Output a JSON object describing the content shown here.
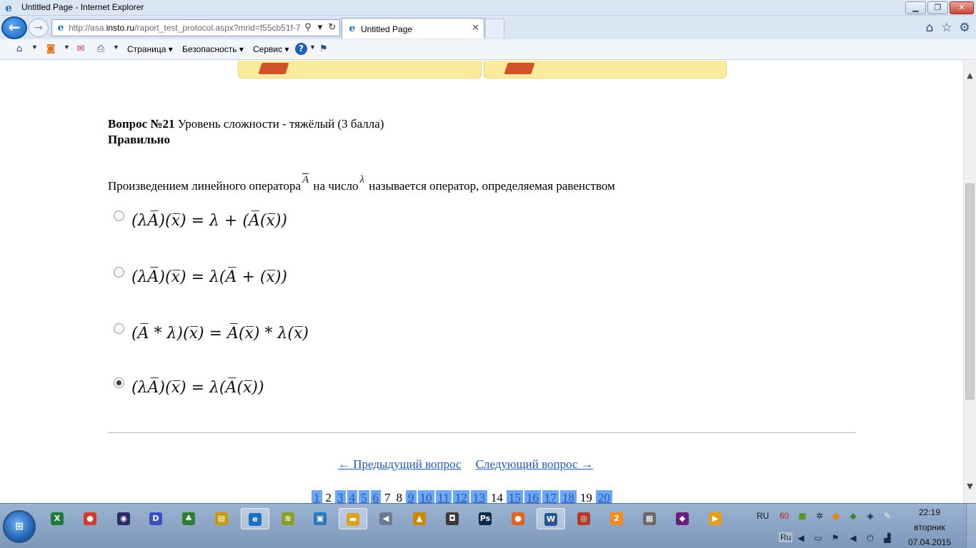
{
  "window": {
    "title": "Untitled Page - Internet Explorer"
  },
  "navbar": {
    "url_prefix": "http://asa.",
    "url_domain": "insto.ru",
    "url_path": "/raport_test_protocol.aspx?mrid=f55cb51f-7",
    "tab_label": "Untitled Page"
  },
  "cmdbar": {
    "menu_page": "Страница",
    "menu_security": "Безопасность",
    "menu_service": "Сервис"
  },
  "question": {
    "heading_bold": "Вопрос №21",
    "heading_rest": " Уровень сложности - тяжёлый (3 балла)",
    "status": "Правильно",
    "text_part1": "Произведением линейного оператора",
    "operator_symbol": "A",
    "text_part2": "на число",
    "lambda_symbol": "λ",
    "text_part3": "называется оператор, определяемая равенством"
  },
  "options": [
    {
      "formula": "(λA̅)(x̅) = λ + (A̅(x̅))",
      "selected": false
    },
    {
      "formula": "(λA̅)(x̅) = λ(A̅ + (x̅))",
      "selected": false
    },
    {
      "formula": "(A̅ * λ)(x̅) = A̅(x̅) * λ(x̅)",
      "selected": false
    },
    {
      "formula": "(λA̅)(x̅) = λ(A̅(x̅))",
      "selected": true
    }
  ],
  "navigation": {
    "prev": "← Предыдущий вопрос",
    "next": "Следующий вопрос →"
  },
  "pager": [
    {
      "label": "1",
      "answered": true
    },
    {
      "label": "2",
      "answered": false
    },
    {
      "label": "3",
      "answered": true
    },
    {
      "label": "4",
      "answered": true
    },
    {
      "label": "5",
      "answered": true
    },
    {
      "label": "6",
      "answered": true
    },
    {
      "label": "7",
      "answered": false
    },
    {
      "label": "8",
      "answered": false
    },
    {
      "label": "9",
      "answered": true
    },
    {
      "label": "10",
      "answered": true
    },
    {
      "label": "11",
      "answered": true
    },
    {
      "label": "12",
      "answered": true
    },
    {
      "label": "13",
      "answered": true
    },
    {
      "label": "14",
      "answered": false
    },
    {
      "label": "15",
      "answered": true
    },
    {
      "label": "16",
      "answered": true
    },
    {
      "label": "17",
      "answered": true
    },
    {
      "label": "18",
      "answered": true
    },
    {
      "label": "19",
      "answered": false
    },
    {
      "label": "20",
      "answered": true
    }
  ],
  "taskbar": {
    "lang_indicator": "RU",
    "tray_number": "60",
    "lang_bar": "Ru",
    "time": "22:19",
    "weekday": "вторник",
    "date": "07.04.2015",
    "apps": [
      {
        "name": "excel-taskbar-icon",
        "glyph": "X",
        "color": "#1d7a3a"
      },
      {
        "name": "chrome-taskbar-icon",
        "glyph": "●",
        "color": "#d33b2c"
      },
      {
        "name": "media-player-taskbar-icon",
        "glyph": "◉",
        "color": "#2b2b6b"
      },
      {
        "name": "daemon-tools-taskbar-icon",
        "glyph": "D",
        "color": "#3b4fbf"
      },
      {
        "name": "network-app-taskbar-icon",
        "glyph": "♣",
        "color": "#2e7d32"
      },
      {
        "name": "notes-taskbar-icon",
        "glyph": "▤",
        "color": "#c49b0d"
      },
      {
        "name": "internet-explorer-taskbar-icon",
        "glyph": "e",
        "color": "#1f6fc4"
      },
      {
        "name": "wifi-app-taskbar-icon",
        "glyph": "≋",
        "color": "#8aa02a"
      },
      {
        "name": "monitor-app-taskbar-icon",
        "glyph": "▣",
        "color": "#2a78b8"
      },
      {
        "name": "explorer-taskbar-icon",
        "glyph": "▬",
        "color": "#d9a321"
      },
      {
        "name": "audio-app-taskbar-icon",
        "glyph": "◀",
        "color": "#6c7a92"
      },
      {
        "name": "warning-app-taskbar-icon",
        "glyph": "▲",
        "color": "#c98a00"
      },
      {
        "name": "camera-taskbar-icon",
        "glyph": "◘",
        "color": "#3a3a3a"
      },
      {
        "name": "photoshop-taskbar-icon",
        "glyph": "Ps",
        "color": "#0a2a4a"
      },
      {
        "name": "firefox-taskbar-icon",
        "glyph": "●",
        "color": "#e0661d"
      },
      {
        "name": "word-taskbar-icon",
        "glyph": "W",
        "color": "#2a5699"
      },
      {
        "name": "game-taskbar-icon",
        "glyph": "◎",
        "color": "#b03a2e"
      },
      {
        "name": "orange-app-taskbar-icon",
        "glyph": "2",
        "color": "#f28c1c"
      },
      {
        "name": "calc-app-taskbar-icon",
        "glyph": "▦",
        "color": "#6a6a6a"
      },
      {
        "name": "visual-studio-taskbar-icon",
        "glyph": "◆",
        "color": "#68217a"
      },
      {
        "name": "video-app-taskbar-icon",
        "glyph": "▶",
        "color": "#e2a014"
      }
    ]
  }
}
